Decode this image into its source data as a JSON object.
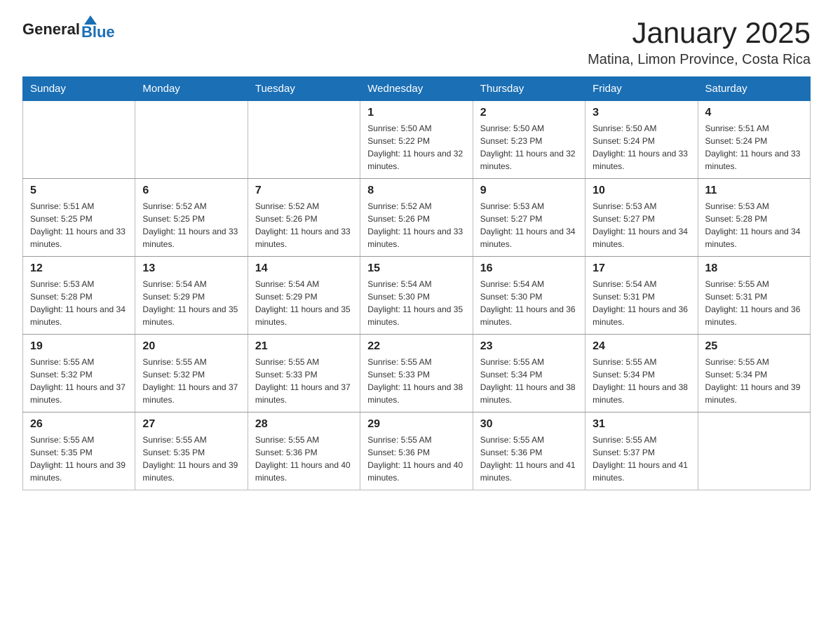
{
  "header": {
    "logo_general": "General",
    "logo_blue": "Blue",
    "title": "January 2025",
    "location": "Matina, Limon Province, Costa Rica"
  },
  "weekdays": [
    "Sunday",
    "Monday",
    "Tuesday",
    "Wednesday",
    "Thursday",
    "Friday",
    "Saturday"
  ],
  "rows": [
    [
      {
        "day": "",
        "sunrise": "",
        "sunset": "",
        "daylight": ""
      },
      {
        "day": "",
        "sunrise": "",
        "sunset": "",
        "daylight": ""
      },
      {
        "day": "",
        "sunrise": "",
        "sunset": "",
        "daylight": ""
      },
      {
        "day": "1",
        "sunrise": "Sunrise: 5:50 AM",
        "sunset": "Sunset: 5:22 PM",
        "daylight": "Daylight: 11 hours and 32 minutes."
      },
      {
        "day": "2",
        "sunrise": "Sunrise: 5:50 AM",
        "sunset": "Sunset: 5:23 PM",
        "daylight": "Daylight: 11 hours and 32 minutes."
      },
      {
        "day": "3",
        "sunrise": "Sunrise: 5:50 AM",
        "sunset": "Sunset: 5:24 PM",
        "daylight": "Daylight: 11 hours and 33 minutes."
      },
      {
        "day": "4",
        "sunrise": "Sunrise: 5:51 AM",
        "sunset": "Sunset: 5:24 PM",
        "daylight": "Daylight: 11 hours and 33 minutes."
      }
    ],
    [
      {
        "day": "5",
        "sunrise": "Sunrise: 5:51 AM",
        "sunset": "Sunset: 5:25 PM",
        "daylight": "Daylight: 11 hours and 33 minutes."
      },
      {
        "day": "6",
        "sunrise": "Sunrise: 5:52 AM",
        "sunset": "Sunset: 5:25 PM",
        "daylight": "Daylight: 11 hours and 33 minutes."
      },
      {
        "day": "7",
        "sunrise": "Sunrise: 5:52 AM",
        "sunset": "Sunset: 5:26 PM",
        "daylight": "Daylight: 11 hours and 33 minutes."
      },
      {
        "day": "8",
        "sunrise": "Sunrise: 5:52 AM",
        "sunset": "Sunset: 5:26 PM",
        "daylight": "Daylight: 11 hours and 33 minutes."
      },
      {
        "day": "9",
        "sunrise": "Sunrise: 5:53 AM",
        "sunset": "Sunset: 5:27 PM",
        "daylight": "Daylight: 11 hours and 34 minutes."
      },
      {
        "day": "10",
        "sunrise": "Sunrise: 5:53 AM",
        "sunset": "Sunset: 5:27 PM",
        "daylight": "Daylight: 11 hours and 34 minutes."
      },
      {
        "day": "11",
        "sunrise": "Sunrise: 5:53 AM",
        "sunset": "Sunset: 5:28 PM",
        "daylight": "Daylight: 11 hours and 34 minutes."
      }
    ],
    [
      {
        "day": "12",
        "sunrise": "Sunrise: 5:53 AM",
        "sunset": "Sunset: 5:28 PM",
        "daylight": "Daylight: 11 hours and 34 minutes."
      },
      {
        "day": "13",
        "sunrise": "Sunrise: 5:54 AM",
        "sunset": "Sunset: 5:29 PM",
        "daylight": "Daylight: 11 hours and 35 minutes."
      },
      {
        "day": "14",
        "sunrise": "Sunrise: 5:54 AM",
        "sunset": "Sunset: 5:29 PM",
        "daylight": "Daylight: 11 hours and 35 minutes."
      },
      {
        "day": "15",
        "sunrise": "Sunrise: 5:54 AM",
        "sunset": "Sunset: 5:30 PM",
        "daylight": "Daylight: 11 hours and 35 minutes."
      },
      {
        "day": "16",
        "sunrise": "Sunrise: 5:54 AM",
        "sunset": "Sunset: 5:30 PM",
        "daylight": "Daylight: 11 hours and 36 minutes."
      },
      {
        "day": "17",
        "sunrise": "Sunrise: 5:54 AM",
        "sunset": "Sunset: 5:31 PM",
        "daylight": "Daylight: 11 hours and 36 minutes."
      },
      {
        "day": "18",
        "sunrise": "Sunrise: 5:55 AM",
        "sunset": "Sunset: 5:31 PM",
        "daylight": "Daylight: 11 hours and 36 minutes."
      }
    ],
    [
      {
        "day": "19",
        "sunrise": "Sunrise: 5:55 AM",
        "sunset": "Sunset: 5:32 PM",
        "daylight": "Daylight: 11 hours and 37 minutes."
      },
      {
        "day": "20",
        "sunrise": "Sunrise: 5:55 AM",
        "sunset": "Sunset: 5:32 PM",
        "daylight": "Daylight: 11 hours and 37 minutes."
      },
      {
        "day": "21",
        "sunrise": "Sunrise: 5:55 AM",
        "sunset": "Sunset: 5:33 PM",
        "daylight": "Daylight: 11 hours and 37 minutes."
      },
      {
        "day": "22",
        "sunrise": "Sunrise: 5:55 AM",
        "sunset": "Sunset: 5:33 PM",
        "daylight": "Daylight: 11 hours and 38 minutes."
      },
      {
        "day": "23",
        "sunrise": "Sunrise: 5:55 AM",
        "sunset": "Sunset: 5:34 PM",
        "daylight": "Daylight: 11 hours and 38 minutes."
      },
      {
        "day": "24",
        "sunrise": "Sunrise: 5:55 AM",
        "sunset": "Sunset: 5:34 PM",
        "daylight": "Daylight: 11 hours and 38 minutes."
      },
      {
        "day": "25",
        "sunrise": "Sunrise: 5:55 AM",
        "sunset": "Sunset: 5:34 PM",
        "daylight": "Daylight: 11 hours and 39 minutes."
      }
    ],
    [
      {
        "day": "26",
        "sunrise": "Sunrise: 5:55 AM",
        "sunset": "Sunset: 5:35 PM",
        "daylight": "Daylight: 11 hours and 39 minutes."
      },
      {
        "day": "27",
        "sunrise": "Sunrise: 5:55 AM",
        "sunset": "Sunset: 5:35 PM",
        "daylight": "Daylight: 11 hours and 39 minutes."
      },
      {
        "day": "28",
        "sunrise": "Sunrise: 5:55 AM",
        "sunset": "Sunset: 5:36 PM",
        "daylight": "Daylight: 11 hours and 40 minutes."
      },
      {
        "day": "29",
        "sunrise": "Sunrise: 5:55 AM",
        "sunset": "Sunset: 5:36 PM",
        "daylight": "Daylight: 11 hours and 40 minutes."
      },
      {
        "day": "30",
        "sunrise": "Sunrise: 5:55 AM",
        "sunset": "Sunset: 5:36 PM",
        "daylight": "Daylight: 11 hours and 41 minutes."
      },
      {
        "day": "31",
        "sunrise": "Sunrise: 5:55 AM",
        "sunset": "Sunset: 5:37 PM",
        "daylight": "Daylight: 11 hours and 41 minutes."
      },
      {
        "day": "",
        "sunrise": "",
        "sunset": "",
        "daylight": ""
      }
    ]
  ]
}
